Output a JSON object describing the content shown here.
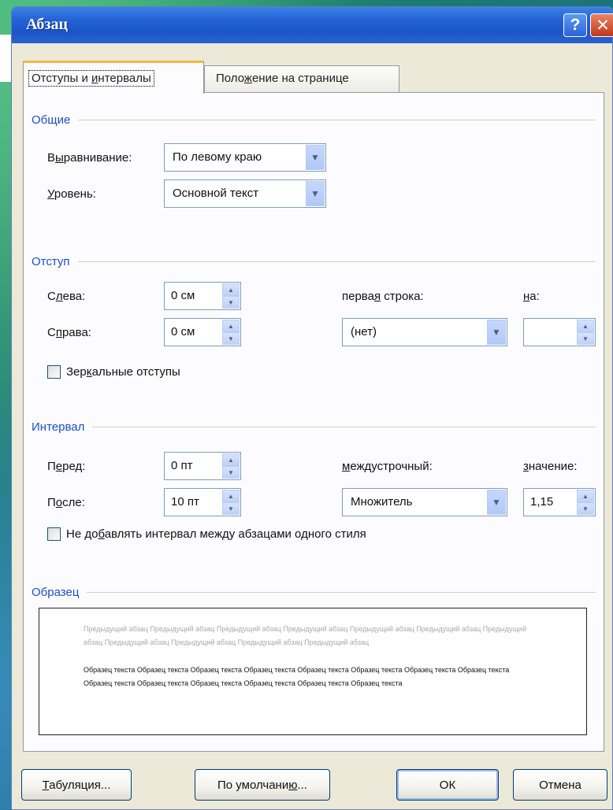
{
  "dialog": {
    "title": "Абзац",
    "help_glyph": "?",
    "close_glyph": "✕"
  },
  "tabs": [
    {
      "label_pre": "Отступы и ",
      "label_u": "и",
      "label_post": "нтервалы",
      "active": true
    },
    {
      "label_pre": "Поло",
      "label_u": "ж",
      "label_post": "ение на странице",
      "active": false
    }
  ],
  "general": {
    "header": "Общие",
    "alignment_label_pre": "В",
    "alignment_label_u": "ы",
    "alignment_label_post": "равнивание:",
    "alignment_value": "По левому краю",
    "level_label_pre": "",
    "level_label_u": "У",
    "level_label_post": "ровень:",
    "level_value": "Основной текст"
  },
  "indent": {
    "header": "Отступ",
    "left_label_pre": "С",
    "left_label_u": "л",
    "left_label_post": "ева:",
    "left_value": "0 см",
    "right_label_pre": "С",
    "right_label_u": "п",
    "right_label_post": "рава:",
    "right_value": "0 см",
    "first_line_label_pre": "перва",
    "first_line_label_u": "я",
    "first_line_label_post": " строка:",
    "first_line_value": "(нет)",
    "by_label_pre": "",
    "by_label_u": "н",
    "by_label_post": "а:",
    "by_value": "",
    "mirror_label_pre": "Зер",
    "mirror_label_u": "к",
    "mirror_label_post": "альные отступы",
    "mirror_checked": false
  },
  "spacing": {
    "header": "Интервал",
    "before_label_pre": "П",
    "before_label_u": "е",
    "before_label_post": "ред:",
    "before_value": "0 пт",
    "after_label_pre": "П",
    "after_label_u": "о",
    "after_label_post": "сле:",
    "after_value": "10 пт",
    "line_label_pre": "",
    "line_label_u": "м",
    "line_label_post": "еждустрочный:",
    "line_value": "Множитель",
    "at_label_pre": "",
    "at_label_u": "з",
    "at_label_post": "начение:",
    "at_value": "1,15",
    "no_space_label_pre": "Не до",
    "no_space_label_u": "б",
    "no_space_label_post": "авлять интервал между абзацами одного стиля",
    "no_space_checked": false
  },
  "preview": {
    "header": "Образец",
    "previous_text": "Предыдущий абзац Предыдущий абзац Предыдущий абзац Предыдущий абзац Предыдущий абзац Предыдущий абзац Предыдущий абзац Предыдущий абзац Предыдущий абзац Предыдущий абзац Предыдущий абзац",
    "sample_text": "Образец текста Образец текста Образец текста Образец текста Образец текста Образец текста Образец текста Образец текста Образец текста Образец текста Образец текста Образец текста Образец текста Образец текста"
  },
  "buttons": {
    "tabs_pre": "",
    "tabs_u": "Т",
    "tabs_post": "абуляция...",
    "default_pre": "По умолчани",
    "default_u": "ю",
    "default_post": "...",
    "ok": "ОК",
    "cancel": "Отмена"
  }
}
